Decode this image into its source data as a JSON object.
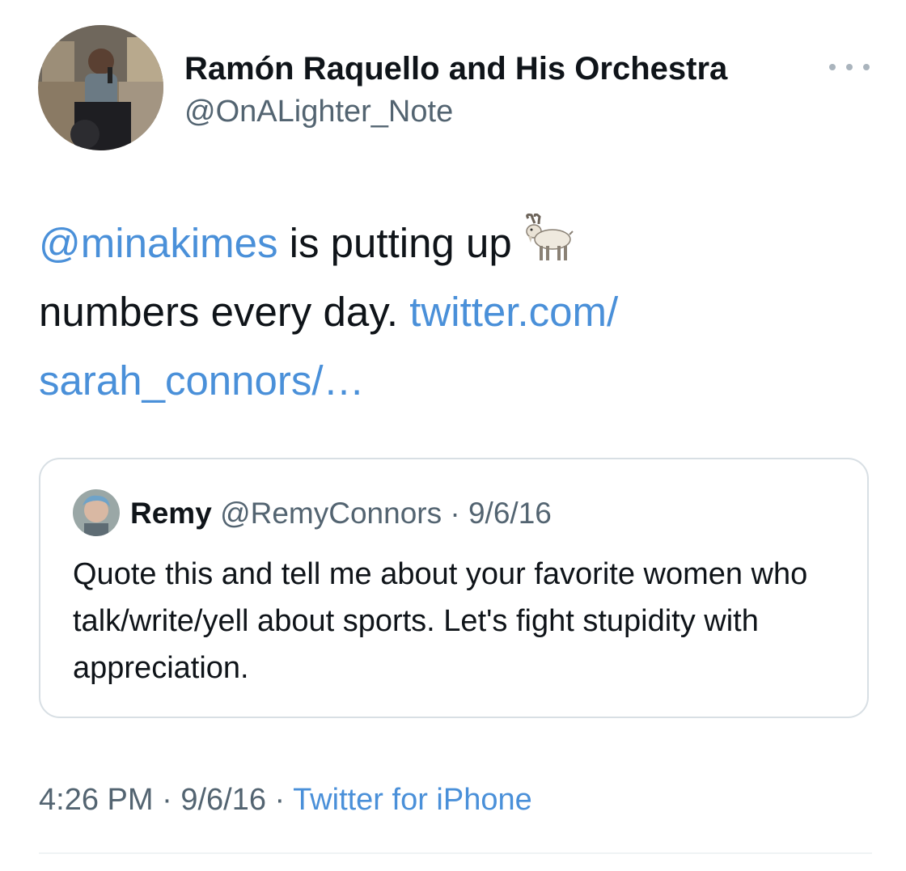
{
  "author": {
    "display_name": "Ramón Raquello and His Orchestra",
    "handle": "@OnALighter_Note"
  },
  "tweet": {
    "mention": "@minakimes",
    "text_part1": " is putting up ",
    "emoji_icon": "goat-icon",
    "text_part2": "numbers every day.  ",
    "link_part1": "twitter.com/",
    "link_part2": "sarah_connors/…"
  },
  "quoted_tweet": {
    "display_name": "Remy",
    "handle": "@RemyConnors",
    "separator": " · ",
    "date": "9/6/16",
    "text": "Quote this and tell me about your favorite women who talk/write/yell about sports. Let's fight stupidity with appreciation."
  },
  "footer": {
    "time": "4:26 PM",
    "separator1": " · ",
    "date": "9/6/16",
    "separator2": " · ",
    "source": "Twitter for iPhone"
  },
  "colors": {
    "link": "#4a90d9",
    "text": "#0f1419",
    "secondary": "#536471",
    "border": "#d8dfe4"
  }
}
